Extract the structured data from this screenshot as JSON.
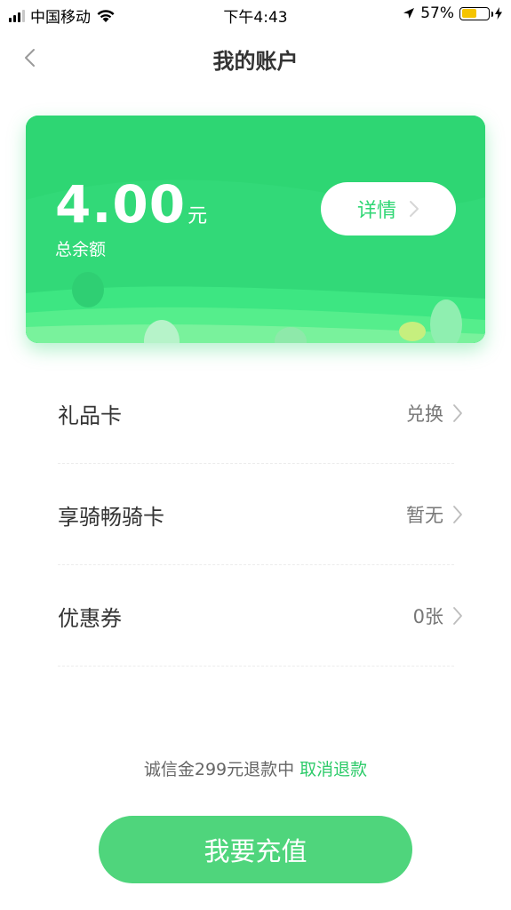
{
  "status_bar": {
    "carrier": "中国移动",
    "time": "下午4:43",
    "battery_percent": "57%",
    "battery_level": 0.57,
    "icons": [
      "signal-icon",
      "wifi-icon",
      "location-arrow-icon",
      "battery-icon",
      "charging-bolt-icon"
    ]
  },
  "header": {
    "title": "我的账户",
    "back_icon": "chevron-left-icon"
  },
  "balance_card": {
    "amount": "4.00",
    "unit": "元",
    "label": "总余额",
    "detail_button_label": "详情",
    "colors": {
      "primary": "#2ed673",
      "hill_light": "#5ff08f"
    }
  },
  "list": {
    "items": [
      {
        "title": "礼品卡",
        "value": "兑换"
      },
      {
        "title": "享骑畅骑卡",
        "value": "暂无"
      },
      {
        "title": "优惠券",
        "value": "0张"
      }
    ]
  },
  "footer": {
    "deposit_text": "诚信金299元退款中",
    "cancel_link": "取消退款",
    "recharge_button": "我要充值",
    "button_color": "#4fd57c"
  }
}
